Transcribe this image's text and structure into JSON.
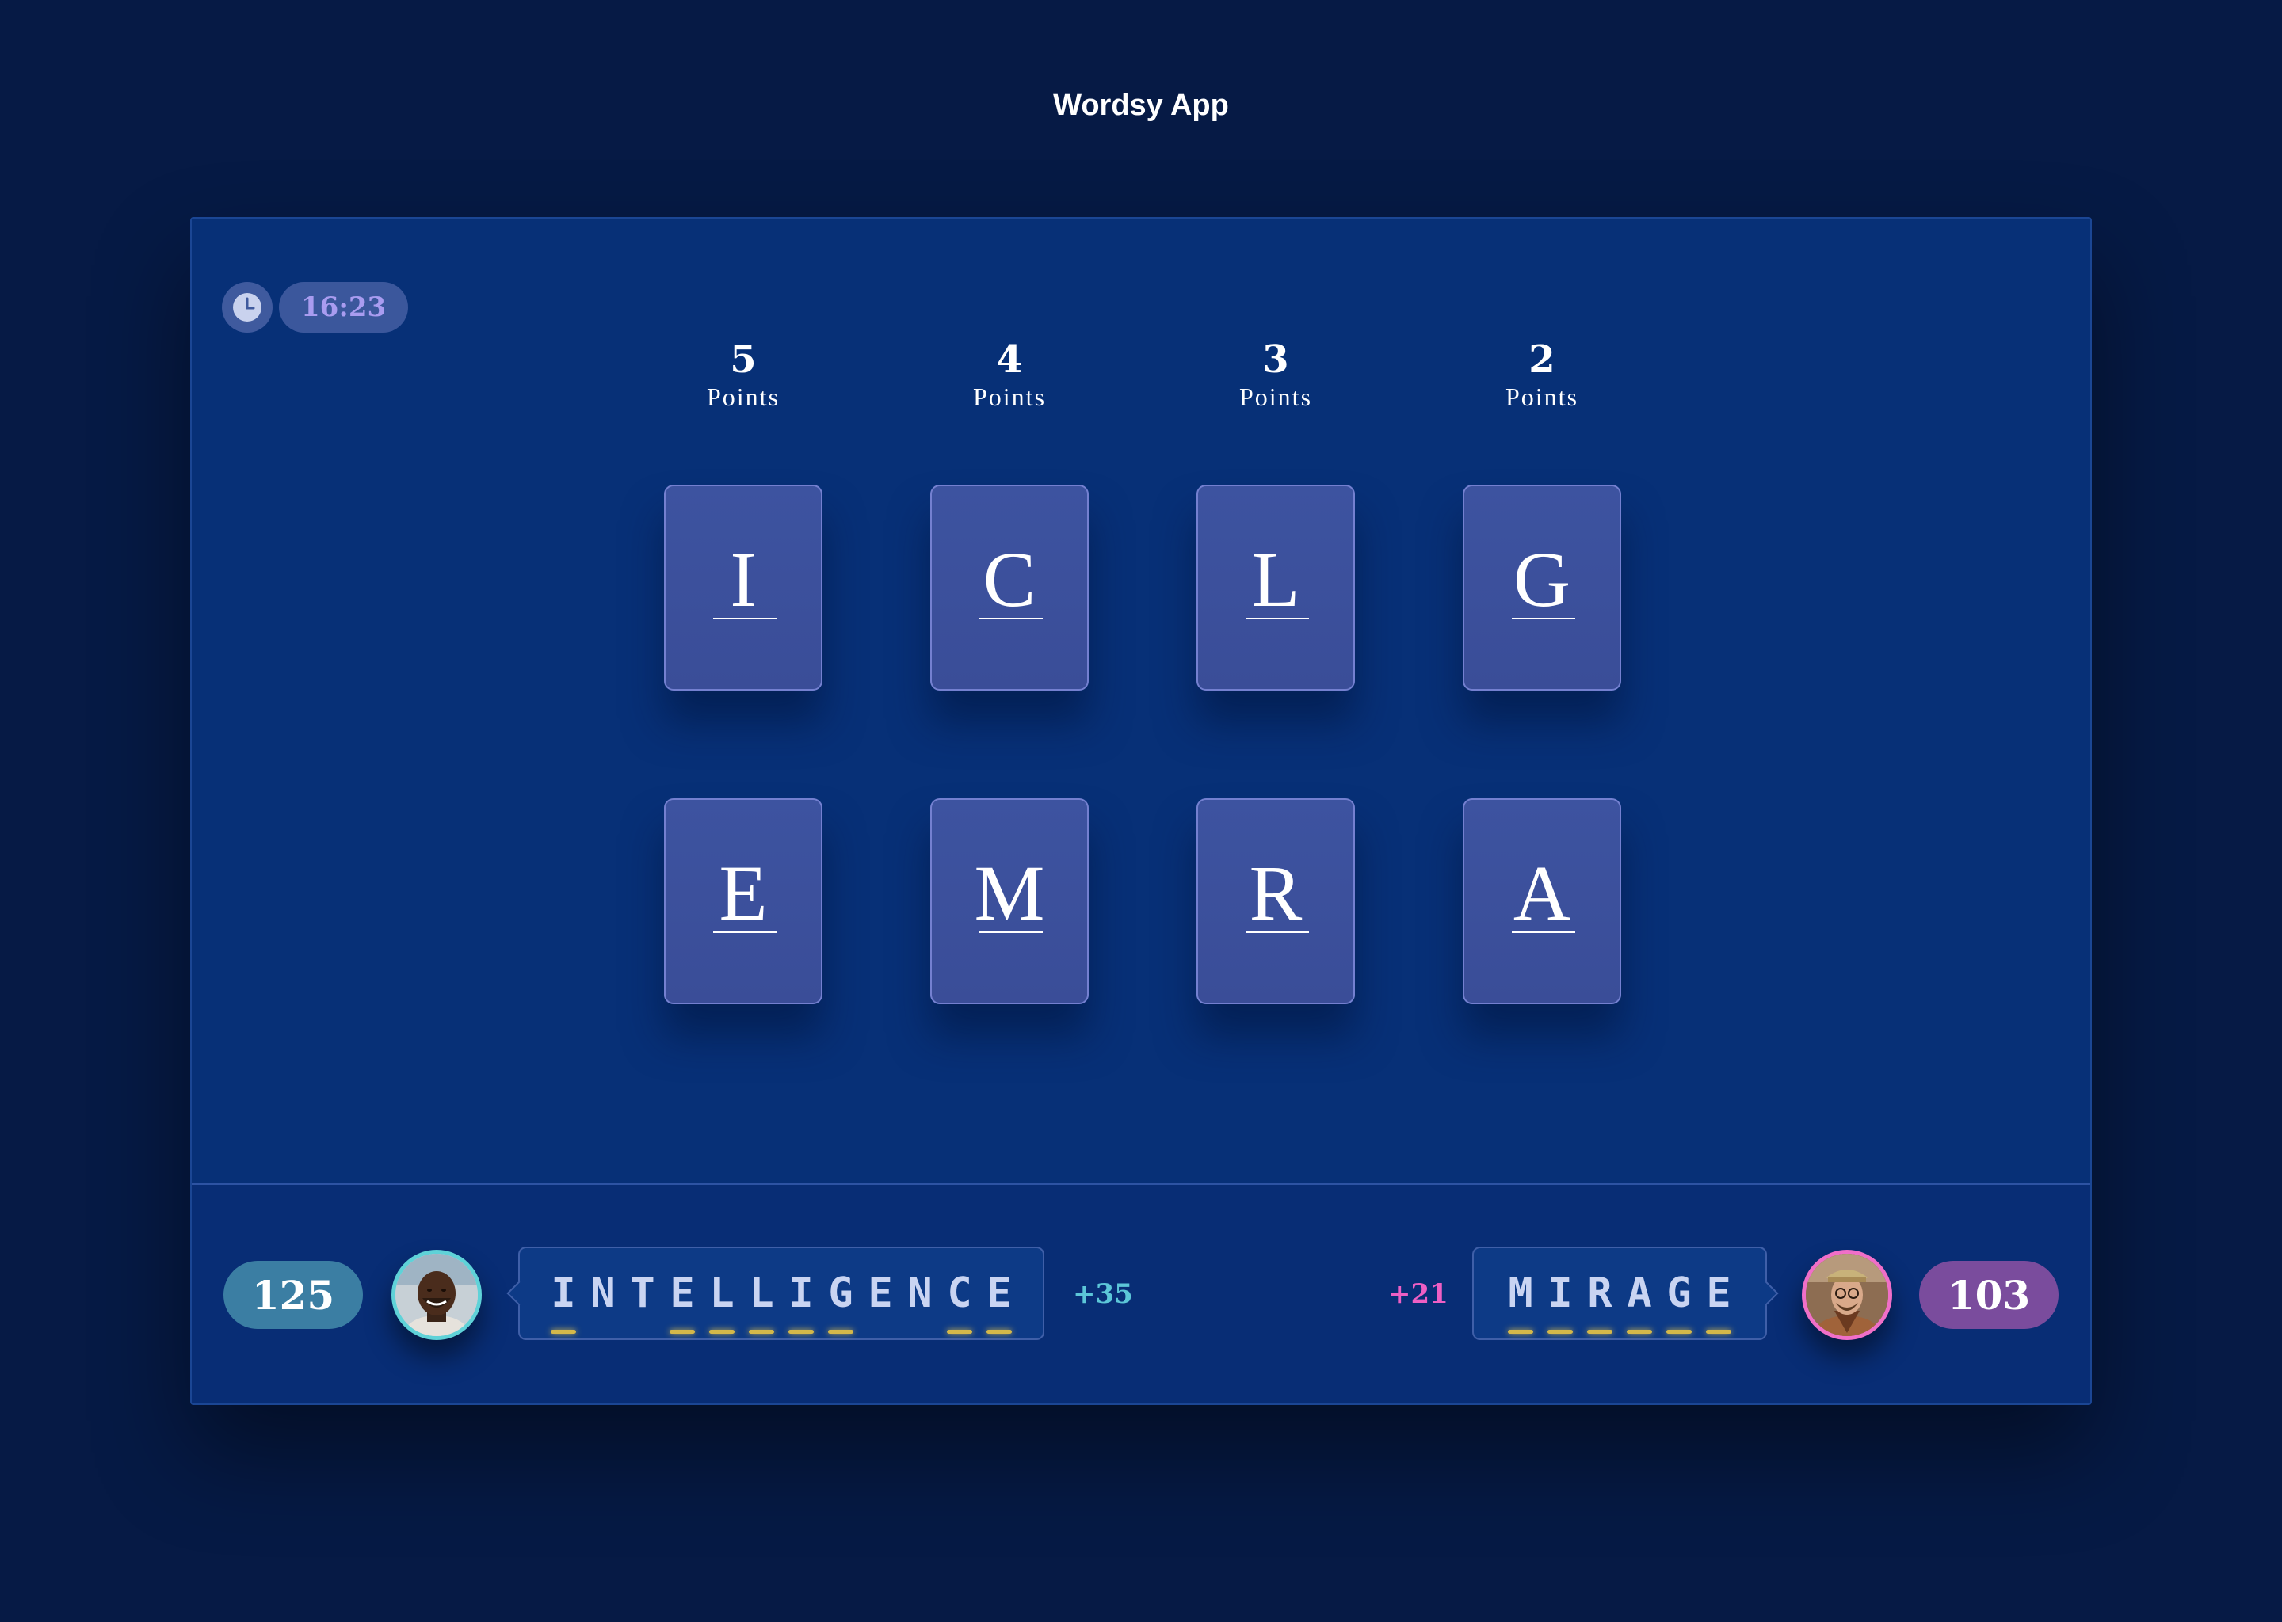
{
  "app": {
    "title": "Wordsy App"
  },
  "timer": {
    "time": "16:23",
    "icon": "clock-icon"
  },
  "columns": [
    {
      "points": "5",
      "label": "Points"
    },
    {
      "points": "4",
      "label": "Points"
    },
    {
      "points": "3",
      "label": "Points"
    },
    {
      "points": "2",
      "label": "Points"
    }
  ],
  "tiles": {
    "row1": [
      "I",
      "C",
      "L",
      "G"
    ],
    "row2": [
      "E",
      "M",
      "R",
      "A"
    ]
  },
  "players": {
    "left": {
      "score": "125",
      "word": [
        "I",
        "N",
        "T",
        "E",
        "L",
        "L",
        "I",
        "G",
        "E",
        "N",
        "C",
        "E"
      ],
      "highlighted": [
        true,
        false,
        false,
        true,
        true,
        true,
        true,
        true,
        false,
        false,
        true,
        true
      ],
      "gain": "+35",
      "accent": "#5fd2d8"
    },
    "right": {
      "score": "103",
      "word": [
        "M",
        "I",
        "R",
        "A",
        "G",
        "E"
      ],
      "highlighted": [
        true,
        true,
        true,
        true,
        true,
        true
      ],
      "gain": "+21",
      "accent": "#f06fc8"
    }
  },
  "colors": {
    "background": "#061a45",
    "board": "#073077",
    "tile": "#3d53a0",
    "highlight": "#d4b84a"
  }
}
